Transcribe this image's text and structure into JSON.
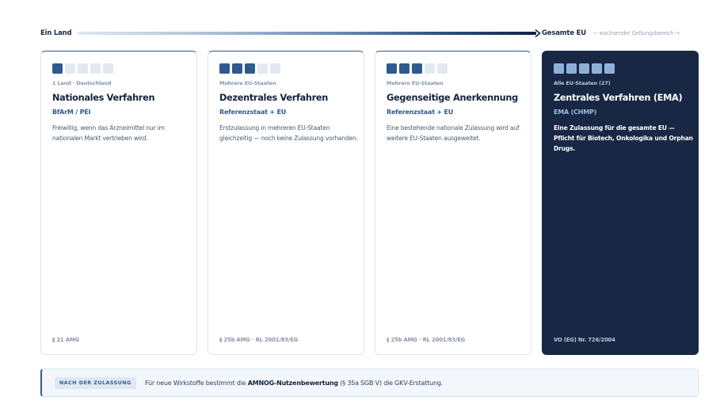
{
  "scale": {
    "start_label": "Ein Land",
    "end_label": "Gesamte EU",
    "note": "— wachsender Geltungsbereich →"
  },
  "cards": [
    {
      "scope": "1 Land · Deutschland",
      "title": "Nationales Verfahren",
      "authority": "BfArM / PEI",
      "description": "Freiwillig, wenn das Arzneimittel nur im nationalen Markt vertrieben wird.",
      "legal": "§ 21 AMG",
      "squares_filled": 1,
      "squares_total": 5
    },
    {
      "scope": "Mehrere EU-Staaten",
      "title": "Dezentrales Verfahren",
      "authority": "Referenzstaat + EU",
      "description": "Erstzulassung in mehreren EU-Staaten gleichzeitig — noch keine Zulassung vorhanden.",
      "legal": "§ 25b AMG · RL 2001/83/EG",
      "squares_filled": 3,
      "squares_total": 5
    },
    {
      "scope": "Mehrere EU-Staaten",
      "title": "Gegenseitige Anerkennung",
      "authority": "Referenzstaat + EU",
      "description": "Eine bestehende nationale Zulassung wird auf weitere EU-Staaten ausgeweitet.",
      "legal": "§ 25b AMG · RL 2001/83/EG",
      "squares_filled": 3,
      "squares_total": 5
    },
    {
      "scope": "Alle EU-Staaten (27)",
      "title": "Zentrales Verfahren (EMA)",
      "authority": "EMA (CHMP)",
      "description": "Eine Zulassung für die gesamte EU — Pflicht für Biotech, Onkologika und Orphan Drugs.",
      "legal": "VO (EG) Nr. 726/2004",
      "squares_filled": 5,
      "squares_total": 5
    }
  ],
  "note": {
    "badge": "NACH DER ZULASSUNG",
    "text_before": "Für neue Wirkstoffe bestimmt die ",
    "text_bold": "AMNOG-Nutzenbewertung",
    "text_after": " (§ 35a SGB V) die GKV-Erstattung."
  },
  "colors": {
    "accent": "#2f5a8e",
    "dark_card": "#172744",
    "square_off": "#e3e9f1",
    "square_on_dark": "#8fb0d6"
  }
}
